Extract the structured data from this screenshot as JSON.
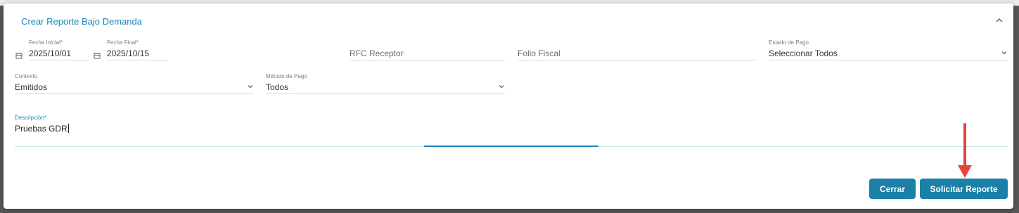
{
  "dialog": {
    "title": "Crear Reporte Bajo Demanda",
    "collapse_icon": "chevron-up-icon"
  },
  "form": {
    "fecha_inicial": {
      "label": "Fecha Inicial*",
      "value": "2025/10/01",
      "icon": "calendar-icon"
    },
    "fecha_final": {
      "label": "Fecha Final*",
      "value": "2025/10/15",
      "icon": "calendar-icon"
    },
    "rfc_receptor": {
      "placeholder": "RFC Receptor",
      "value": ""
    },
    "folio_fiscal": {
      "placeholder": "Folio Fiscal",
      "value": ""
    },
    "estado_de_pago": {
      "label": "Estado de Pago",
      "value": "Seleccionar Todos"
    },
    "contexto": {
      "label": "Contexto",
      "value": "Emitidos"
    },
    "metodo_de_pago": {
      "label": "Método de Pago",
      "value": "Todos"
    },
    "descripcion": {
      "label": "Descripción*",
      "value": "Pruebas GDR"
    }
  },
  "actions": {
    "cerrar_label": "Cerrar",
    "solicitar_label": "Solicitar Reporte"
  },
  "colors": {
    "accent": "#1a87b8",
    "button": "#1a80a8",
    "annotation_arrow": "#e8453c"
  }
}
